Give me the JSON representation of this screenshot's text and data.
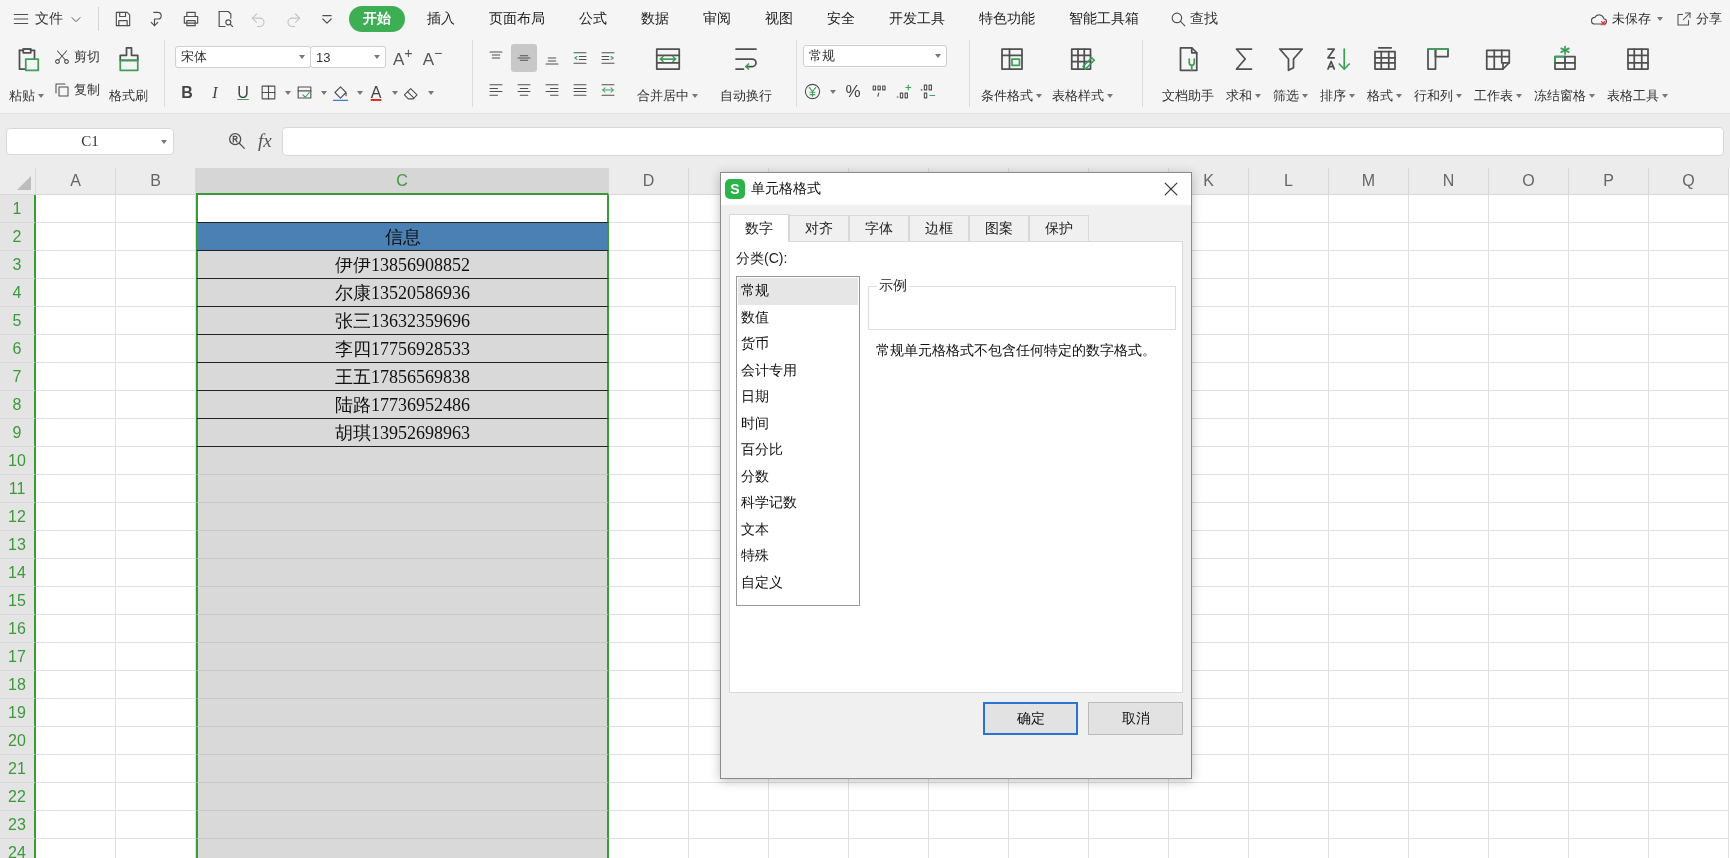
{
  "menu_bar": {
    "file_menu": "文件",
    "quick_access": [
      {
        "kind": "save",
        "disabled": false
      },
      {
        "kind": "export",
        "disabled": false
      },
      {
        "kind": "print",
        "disabled": false
      },
      {
        "kind": "preview",
        "disabled": false
      },
      {
        "kind": "undo",
        "disabled": true
      },
      {
        "kind": "redo",
        "disabled": true
      },
      {
        "kind": "customize",
        "disabled": false
      }
    ],
    "tabs": [
      {
        "label": "开始",
        "selected": true
      },
      {
        "label": "插入",
        "selected": false
      },
      {
        "label": "页面布局",
        "selected": false
      },
      {
        "label": "公式",
        "selected": false
      },
      {
        "label": "数据",
        "selected": false
      },
      {
        "label": "审阅",
        "selected": false
      },
      {
        "label": "视图",
        "selected": false
      },
      {
        "label": "安全",
        "selected": false
      },
      {
        "label": "开发工具",
        "selected": false
      },
      {
        "label": "特色功能",
        "selected": false
      },
      {
        "label": "智能工具箱",
        "selected": false
      }
    ],
    "search": "查找",
    "save_status": "未保存",
    "share": "分享"
  },
  "ribbon": {
    "clipboard": {
      "paste": "粘贴",
      "cut": "剪切",
      "copy": "复制",
      "format_painter": "格式刷"
    },
    "font": {
      "name": "宋体",
      "size": "13",
      "grow": "A$^{+}$",
      "shrink": "A$^{−}$",
      "bold": "B",
      "italic": "I",
      "underline": "U",
      "font_color": "A"
    },
    "align_buttons": [
      {
        "kind": "top",
        "selected": false
      },
      {
        "kind": "middle",
        "selected": true
      },
      {
        "kind": "bottom",
        "selected": false
      },
      {
        "kind": "outdent",
        "selected": false
      },
      {
        "kind": "indent",
        "selected": false
      },
      {
        "kind": "left",
        "selected": false
      },
      {
        "kind": "center",
        "selected": false
      },
      {
        "kind": "right",
        "selected": false
      },
      {
        "kind": "justify",
        "selected": false
      },
      {
        "kind": "distributed",
        "selected": false
      }
    ],
    "merge": "合并居中",
    "wrap": "自动换行",
    "number": {
      "format": "常规",
      "percent": "%"
    },
    "style_buttons": [
      {
        "kind": "conditional",
        "label": "条件格式",
        "dropdown": true
      },
      {
        "kind": "table_style",
        "label": "表格样式",
        "dropdown": true
      }
    ],
    "tool_buttons": [
      {
        "kind": "doc",
        "label": "文档助手",
        "dropdown": false
      },
      {
        "kind": "sum",
        "label": "求和",
        "dropdown": true
      },
      {
        "kind": "filter",
        "label": "筛选",
        "dropdown": true
      },
      {
        "kind": "sort",
        "label": "排序",
        "dropdown": true
      },
      {
        "kind": "format",
        "label": "格式",
        "dropdown": true
      },
      {
        "kind": "rowcol",
        "label": "行和列",
        "dropdown": true
      },
      {
        "kind": "worksheet",
        "label": "工作表",
        "dropdown": true
      },
      {
        "kind": "freeze",
        "label": "冻结窗格",
        "dropdown": true
      },
      {
        "kind": "tabletools",
        "label": "表格工具",
        "dropdown": true
      }
    ]
  },
  "formula_bar": {
    "cell_ref": "C1",
    "fx": "fx"
  },
  "sheet": {
    "columns_left": [
      {
        "label": "A",
        "selected": false
      },
      {
        "label": "B",
        "selected": false
      },
      {
        "label": "C",
        "selected": true
      },
      {
        "label": "D",
        "selected": false
      }
    ],
    "columns_right": [
      {
        "label": "K",
        "selected": false
      },
      {
        "label": "L",
        "selected": false
      },
      {
        "label": "M",
        "selected": false
      },
      {
        "label": "N",
        "selected": false
      },
      {
        "label": "O",
        "selected": false
      },
      {
        "label": "P",
        "selected": false
      },
      {
        "label": "Q",
        "selected": false
      }
    ],
    "rows": [
      {
        "number": "1",
        "selected": true,
        "kind": "active"
      },
      {
        "number": "2",
        "selected": true,
        "kind": "header",
        "c": "信息"
      },
      {
        "number": "3",
        "selected": true,
        "kind": "data",
        "c": "伊伊13856908852"
      },
      {
        "number": "4",
        "selected": true,
        "kind": "data",
        "c": "尔康13520586936"
      },
      {
        "number": "5",
        "selected": true,
        "kind": "data",
        "c": "张三13632359696"
      },
      {
        "number": "6",
        "selected": true,
        "kind": "data",
        "c": "李四17756928533"
      },
      {
        "number": "7",
        "selected": true,
        "kind": "data",
        "c": "王五17856569838"
      },
      {
        "number": "8",
        "selected": true,
        "kind": "data",
        "c": "陆路17736952486"
      },
      {
        "number": "9",
        "selected": true,
        "kind": "data",
        "c": "胡琪13952698963"
      },
      {
        "number": "10",
        "selected": true,
        "kind": "blank"
      },
      {
        "number": "11",
        "selected": true,
        "kind": "blank"
      },
      {
        "number": "12",
        "selected": true,
        "kind": "blank"
      },
      {
        "number": "13",
        "selected": true,
        "kind": "blank"
      },
      {
        "number": "14",
        "selected": true,
        "kind": "blank"
      },
      {
        "number": "15",
        "selected": true,
        "kind": "blank"
      },
      {
        "number": "16",
        "selected": true,
        "kind": "blank"
      },
      {
        "number": "17",
        "selected": true,
        "kind": "blank"
      },
      {
        "number": "18",
        "selected": true,
        "kind": "blank"
      },
      {
        "number": "19",
        "selected": true,
        "kind": "blank"
      },
      {
        "number": "20",
        "selected": true,
        "kind": "blank"
      },
      {
        "number": "21",
        "selected": true,
        "kind": "blank"
      },
      {
        "number": "22",
        "selected": true,
        "kind": "blank"
      },
      {
        "number": "23",
        "selected": true,
        "kind": "blank"
      },
      {
        "number": "24",
        "selected": true,
        "kind": "blank"
      }
    ]
  },
  "dialog": {
    "app_badge": "S",
    "title": "单元格格式",
    "tabs": [
      {
        "label": "数字",
        "selected": true
      },
      {
        "label": "对齐",
        "selected": false
      },
      {
        "label": "字体",
        "selected": false
      },
      {
        "label": "边框",
        "selected": false
      },
      {
        "label": "图案",
        "selected": false
      },
      {
        "label": "保护",
        "selected": false
      }
    ],
    "category_label": "分类(C):",
    "categories": [
      {
        "label": "常规",
        "selected": true
      },
      {
        "label": "数值",
        "selected": false
      },
      {
        "label": "货币",
        "selected": false
      },
      {
        "label": "会计专用",
        "selected": false
      },
      {
        "label": "日期",
        "selected": false
      },
      {
        "label": "时间",
        "selected": false
      },
      {
        "label": "百分比",
        "selected": false
      },
      {
        "label": "分数",
        "selected": false
      },
      {
        "label": "科学记数",
        "selected": false
      },
      {
        "label": "文本",
        "selected": false
      },
      {
        "label": "特殊",
        "selected": false
      },
      {
        "label": "自定义",
        "selected": false
      }
    ],
    "sample_label": "示例",
    "description": "常规单元格格式不包含任何特定的数字格式。",
    "buttons": [
      {
        "label": "确定",
        "kind": "primary"
      },
      {
        "label": "取消",
        "kind": "secondary"
      }
    ]
  }
}
